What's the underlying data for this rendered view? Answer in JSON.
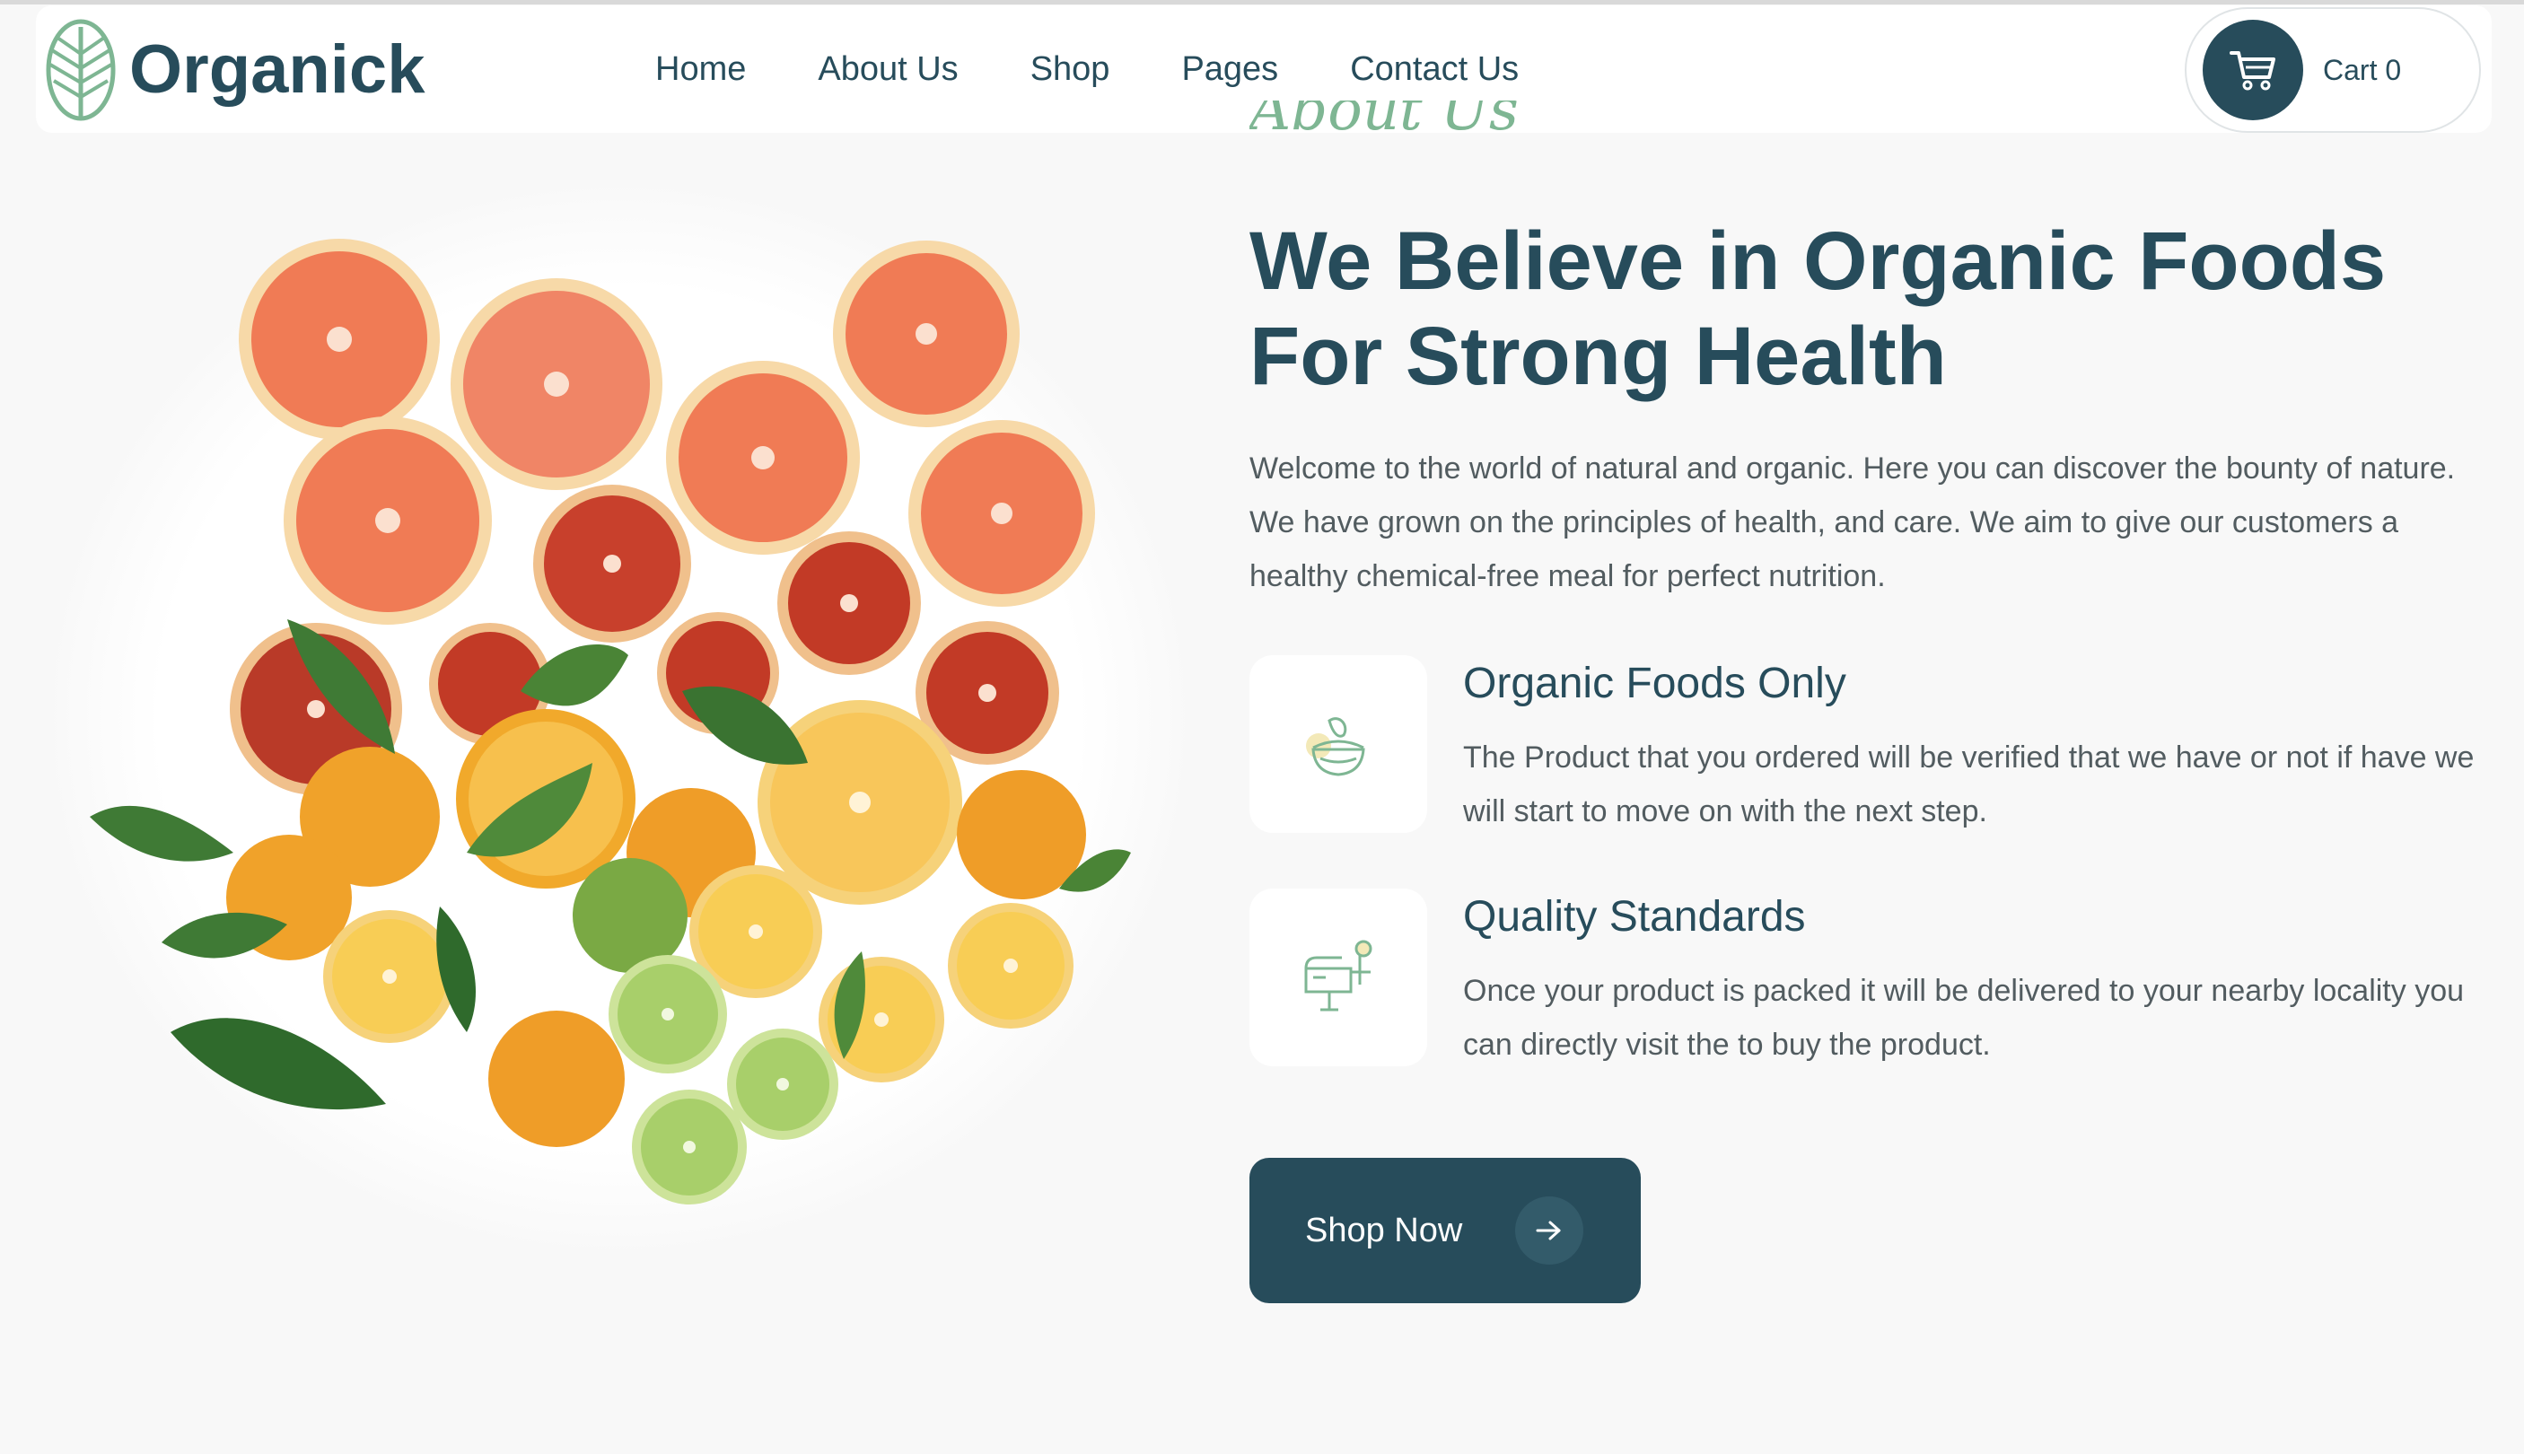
{
  "brand": {
    "name": "Organick"
  },
  "nav": {
    "items": [
      {
        "label": "Home"
      },
      {
        "label": "About Us"
      },
      {
        "label": "Shop"
      },
      {
        "label": "Pages"
      },
      {
        "label": "Contact Us"
      }
    ],
    "cart_label": "Cart 0"
  },
  "about": {
    "eyebrow": "About Us",
    "headline": "We Believe in Organic Foods For Strong Health",
    "intro": "Welcome to the world of natural and organic. Here you can discover the bounty of nature. We have grown on the principles of health, and care. We aim to give our customers a healthy chemical-free meal for perfect nutrition.",
    "features": [
      {
        "icon": "salad-bowl-icon",
        "title": "Organic Foods Only",
        "desc": "The Product that you ordered will be verified that we have or not if have we will start to move on with the next step."
      },
      {
        "icon": "mailbox-icon",
        "title": "Quality Standards",
        "desc": "Once your product is packed it will be delivered to your nearby locality you can directly visit the to buy the product."
      }
    ],
    "cta_label": "Shop Now"
  },
  "colors": {
    "primary": "#274c5b",
    "accent": "#7eb693",
    "background": "#f8f8f8",
    "body_text": "#525c60"
  }
}
